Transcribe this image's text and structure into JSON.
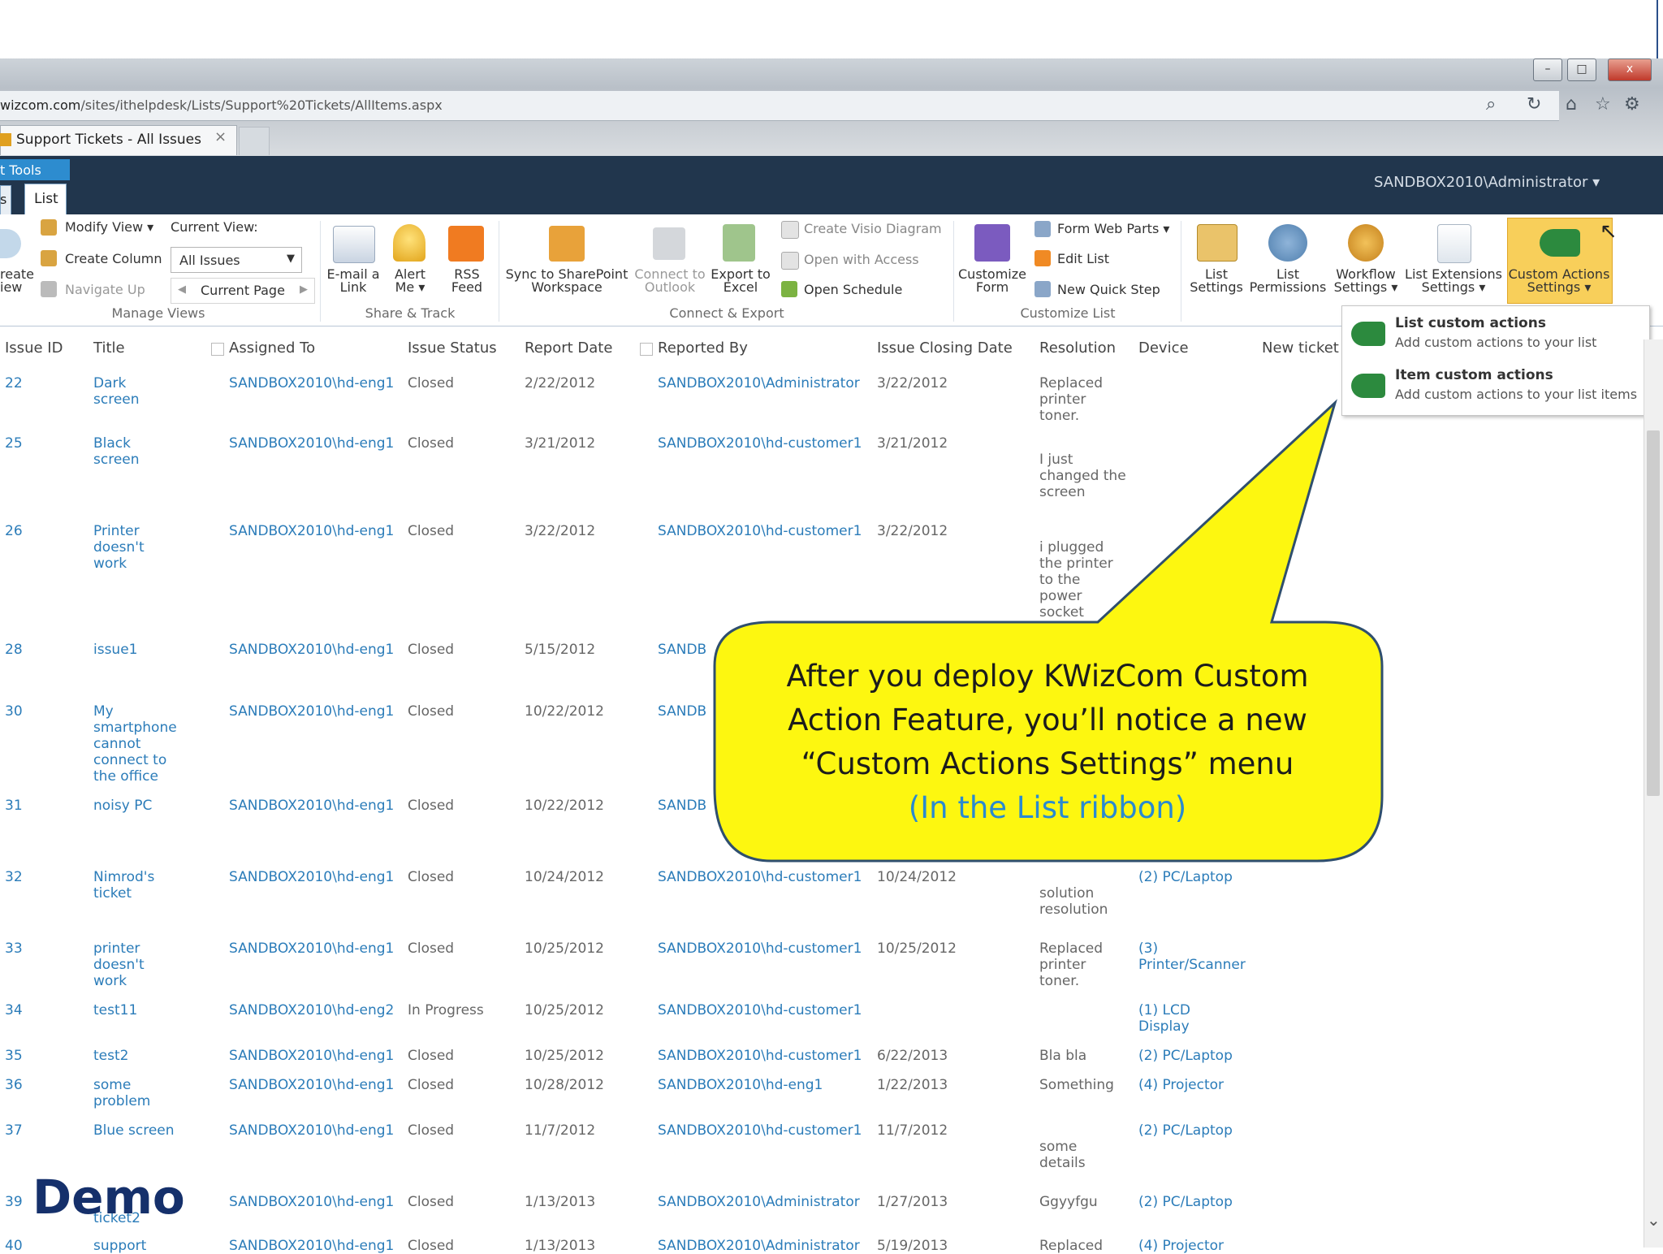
{
  "browser": {
    "url_host": "wizcom.com",
    "url_path": "/sites/ithelpdesk/Lists/Support%20Tickets/AllItems.aspx",
    "tab_title": "Support Tickets - All Issues",
    "tab_close": "×",
    "min": "–",
    "max": "□",
    "close": "x",
    "search_icon": "⌕",
    "refresh_icon": "↻",
    "home_icon": "⌂",
    "star_icon": "☆",
    "gear_icon": "⚙"
  },
  "suite": {
    "context_label": "t Tools",
    "items_tab": "s",
    "list_tab": "List",
    "user": "SANDBOX2010\\Administrator ▾"
  },
  "ribbon": {
    "manage": {
      "create_view": "reate\niew",
      "modify_view": "Modify View ▾",
      "create_column": "Create Column",
      "navigate_up": "Navigate Up",
      "current_view_label": "Current View:",
      "current_view_value": "All Issues",
      "current_page": "Current Page",
      "group": "Manage Views"
    },
    "share": {
      "email": "E-mail a\nLink",
      "alert": "Alert\nMe ▾",
      "rss": "RSS\nFeed",
      "group": "Share & Track"
    },
    "connect": {
      "sync": "Sync to SharePoint\nWorkspace",
      "outlook": "Connect to\nOutlook",
      "excel": "Export to\nExcel",
      "visio": "Create Visio Diagram",
      "access": "Open with Access",
      "schedule": "Open Schedule",
      "group": "Connect & Export"
    },
    "customize": {
      "form": "Customize\nForm",
      "web_parts": "Form Web Parts ▾",
      "edit_list": "Edit List",
      "quick_step": "New Quick Step",
      "group": "Customize List"
    },
    "settings": {
      "list_settings": "List\nSettings",
      "list_permissions": "List\nPermissions",
      "workflow": "Workflow\nSettings ▾",
      "extensions": "List Extensions\nSettings ▾",
      "custom_actions": "Custom Actions\nSettings ▾"
    }
  },
  "dropdown": {
    "item1_title": "List custom actions",
    "item1_desc": "Add custom actions to your list",
    "item2_title": "Item custom actions",
    "item2_desc": "Add custom actions to your list items"
  },
  "columns": {
    "id": "Issue ID",
    "title": "Title",
    "assigned": "Assigned To",
    "status": "Issue Status",
    "report": "Report Date",
    "reported_by": "Reported By",
    "closing": "Issue Closing Date",
    "resolution": "Resolution",
    "device": "Device",
    "new_ticket": "New ticket"
  },
  "rows": [
    {
      "id": "22",
      "title": "Dark\nscreen",
      "assigned": "SANDBOX2010\\hd-eng1",
      "status": "Closed",
      "report": "2/22/2012",
      "by": "SANDBOX2010\\Administrator",
      "closing": "3/22/2012",
      "resolution": "Replaced\nprinter\ntoner.",
      "device": ""
    },
    {
      "id": "25",
      "title": "Black\nscreen",
      "assigned": "SANDBOX2010\\hd-eng1",
      "status": "Closed",
      "report": "3/21/2012",
      "by": "SANDBOX2010\\hd-customer1",
      "closing": "3/21/2012",
      "resolution": "\nI just\nchanged the\nscreen",
      "device": ""
    },
    {
      "id": "26",
      "title": "Printer\ndoesn't\nwork",
      "assigned": "SANDBOX2010\\hd-eng1",
      "status": "Closed",
      "report": "3/22/2012",
      "by": "SANDBOX2010\\hd-customer1",
      "closing": "3/22/2012",
      "resolution": "\ni plugged\nthe printer\nto the\npower\nsocket",
      "device": ""
    },
    {
      "id": "28",
      "title": "issue1",
      "assigned": "SANDBOX2010\\hd-eng1",
      "status": "Closed",
      "report": "5/15/2012",
      "by": "SANDB",
      "closing": "",
      "resolution": "",
      "device": ""
    },
    {
      "id": "30",
      "title": "My\nsmartphone\ncannot\nconnect to\nthe office",
      "assigned": "SANDBOX2010\\hd-eng1",
      "status": "Closed",
      "report": "10/22/2012",
      "by": "SANDB",
      "closing": "",
      "resolution": "",
      "device": ""
    },
    {
      "id": "31",
      "title": "noisy PC",
      "assigned": "SANDBOX2010\\hd-eng1",
      "status": "Closed",
      "report": "10/22/2012",
      "by": "SANDB",
      "closing": "",
      "resolution": "",
      "device": ""
    },
    {
      "id": "32",
      "title": "Nimrod's\nticket",
      "assigned": "SANDBOX2010\\hd-eng1",
      "status": "Closed",
      "report": "10/24/2012",
      "by": "SANDBOX2010\\hd-customer1",
      "closing": "10/24/2012",
      "resolution": "\nsolution\nresolution",
      "device": "(2) PC/Laptop"
    },
    {
      "id": "33",
      "title": "printer\ndoesn't\nwork",
      "assigned": "SANDBOX2010\\hd-eng1",
      "status": "Closed",
      "report": "10/25/2012",
      "by": "SANDBOX2010\\hd-customer1",
      "closing": "10/25/2012",
      "resolution": "Replaced\nprinter\ntoner.",
      "device": "(3)\nPrinter/Scanner"
    },
    {
      "id": "34",
      "title": "test11",
      "assigned": "SANDBOX2010\\hd-eng2",
      "status": "In Progress",
      "report": "10/25/2012",
      "by": "SANDBOX2010\\hd-customer1",
      "closing": "",
      "resolution": "",
      "device": "(1) LCD\nDisplay"
    },
    {
      "id": "35",
      "title": "test2",
      "assigned": "SANDBOX2010\\hd-eng1",
      "status": "Closed",
      "report": "10/25/2012",
      "by": "SANDBOX2010\\hd-customer1",
      "closing": "6/22/2013",
      "resolution": "Bla bla",
      "device": "(2) PC/Laptop"
    },
    {
      "id": "36",
      "title": "some\nproblem",
      "assigned": "SANDBOX2010\\hd-eng1",
      "status": "Closed",
      "report": "10/28/2012",
      "by": "SANDBOX2010\\hd-eng1",
      "closing": "1/22/2013",
      "resolution": "Something",
      "device": "(4) Projector"
    },
    {
      "id": "37",
      "title": "Blue screen",
      "assigned": "SANDBOX2010\\hd-eng1",
      "status": "Closed",
      "report": "11/7/2012",
      "by": "SANDBOX2010\\hd-customer1",
      "closing": "11/7/2012",
      "resolution": "\nsome\ndetails",
      "device": "(2) PC/Laptop"
    },
    {
      "id": "39",
      "title": "\nticket2",
      "assigned": "SANDBOX2010\\hd-eng1",
      "status": "Closed",
      "report": "1/13/2013",
      "by": "SANDBOX2010\\Administrator",
      "closing": "1/27/2013",
      "resolution": "Ggyyfgu",
      "device": "(2) PC/Laptop"
    },
    {
      "id": "40",
      "title": "support",
      "assigned": "SANDBOX2010\\hd-eng1",
      "status": "Closed",
      "report": "1/13/2013",
      "by": "SANDBOX2010\\Administrator",
      "closing": "5/19/2013",
      "resolution": "Replaced",
      "device": "(4) Projector"
    }
  ],
  "callout": {
    "line1": "After you deploy KWizCom Custom",
    "line2": "Action Feature, you’ll notice a new",
    "line3": "“Custom Actions Settings” menu",
    "line4": "(In the List ribbon)"
  },
  "demo_label": "Demo",
  "colors": {
    "suite_bar": "#21364d",
    "link": "#2b7cb9",
    "callout": "#fdf710",
    "highlight": "#f8cf5a"
  }
}
